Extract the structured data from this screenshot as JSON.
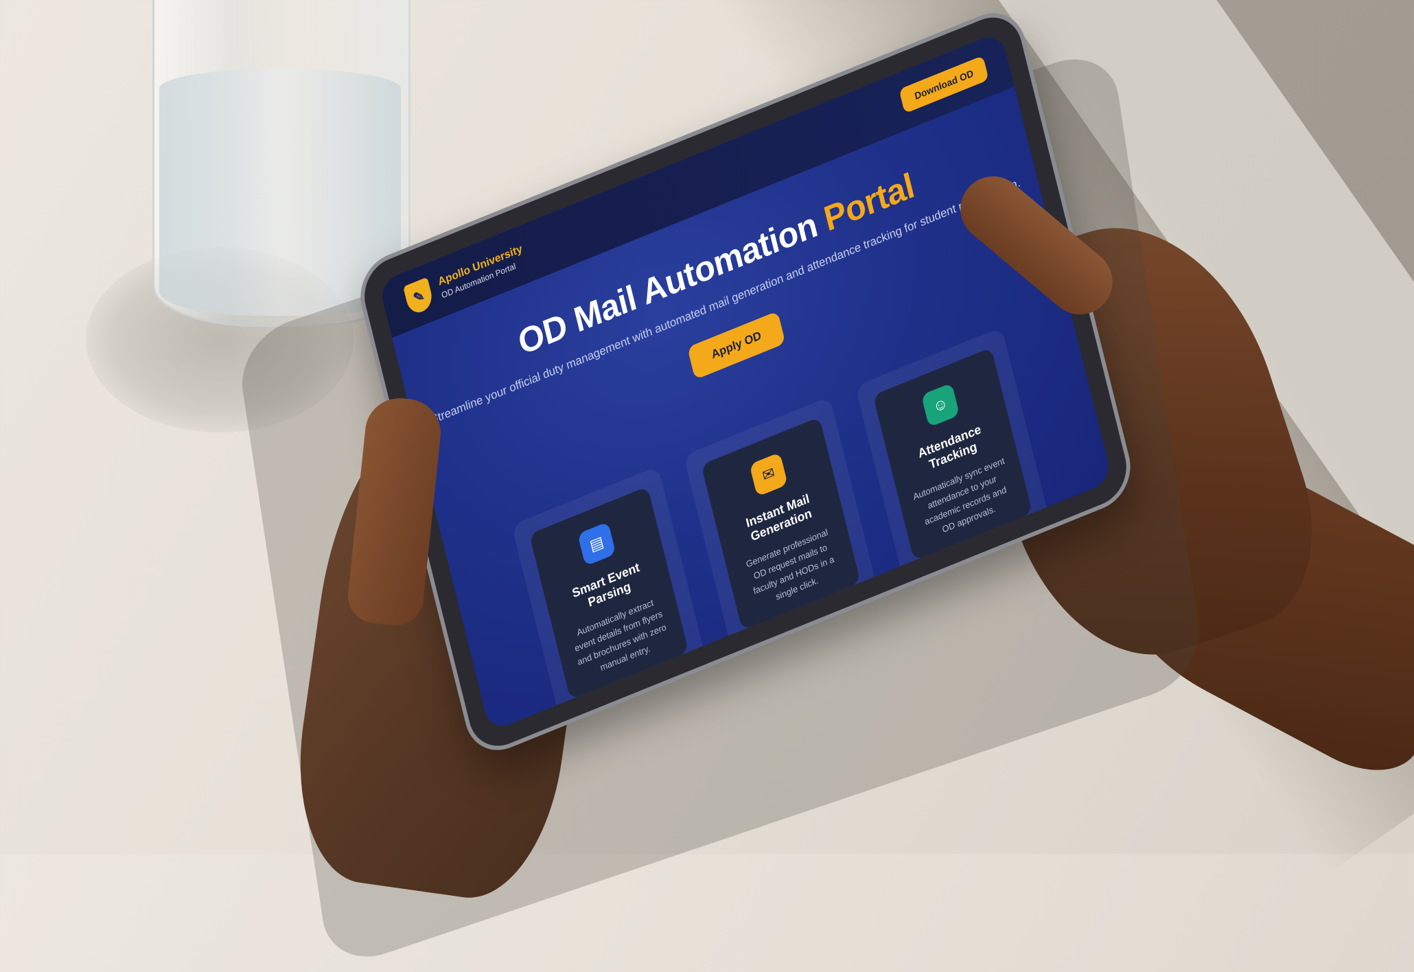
{
  "header": {
    "brand_name": "Apollo University",
    "brand_sub": "OD Automation Portal",
    "top_button": "Download OD"
  },
  "hero": {
    "title_main": "OD Mail Automation",
    "title_accent": "Portal",
    "subtitle": "Streamline your official duty management with automated mail generation and attendance tracking for student participation.",
    "cta": "Apply OD"
  },
  "cards": [
    {
      "icon": "document-icon",
      "icon_color": "#2f6fe8",
      "title": "Smart Event Parsing",
      "desc": "Automatically extract event details from flyers and brochures with zero manual entry."
    },
    {
      "icon": "mail-icon",
      "icon_color": "#f4a91a",
      "title": "Instant Mail Generation",
      "desc": "Generate professional OD request mails to faculty and HODs in a single click."
    },
    {
      "icon": "user-icon",
      "icon_color": "#19a37a",
      "title": "Attendance Tracking",
      "desc": "Automatically sync event attendance to your academic records and OD approvals."
    }
  ],
  "colors": {
    "primary": "#1f318a",
    "accent": "#f4a91a"
  }
}
